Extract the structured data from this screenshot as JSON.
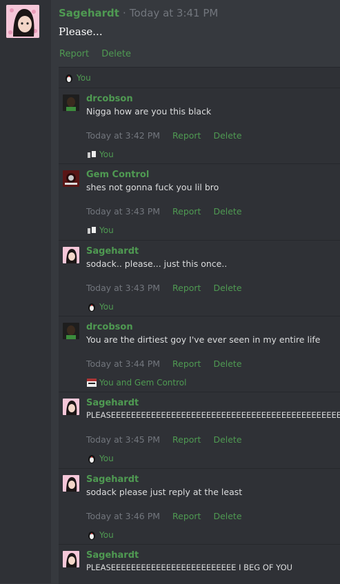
{
  "main": {
    "author": "Sagehardt",
    "separator": "·",
    "time": "Today at 3:41 PM",
    "text": "Please...",
    "actions": [
      "Report",
      "Delete"
    ]
  },
  "thread_reactor": "You",
  "replies": [
    {
      "author": "drcobson",
      "text": "Nigga how are you this black",
      "time": "Today at 3:42 PM",
      "report": "Report",
      "delete": "Delete",
      "reactor": "You",
      "avatar": "drcobson"
    },
    {
      "author": "Gem Control",
      "text": "shes not gonna fuck you lil bro",
      "time": "Today at 3:43 PM",
      "report": "Report",
      "delete": "Delete",
      "reactor": "You",
      "avatar": "gem"
    },
    {
      "author": "Sagehardt",
      "text": "sodack.. please... just this once..",
      "time": "Today at 3:43 PM",
      "report": "Report",
      "delete": "Delete",
      "reactor": "You",
      "avatar": "sage"
    },
    {
      "author": "drcobson",
      "text": "You are the dirtiest goy I've ever seen in my entire life",
      "time": "Today at 3:44 PM",
      "report": "Report",
      "delete": "Delete",
      "reactor": "You and Gem Control",
      "avatar": "drcobson"
    },
    {
      "author": "Sagehardt",
      "text": "PLEASEEEEEEEEEEEEEEEEEEEEEEEEEEEEEEEEEEEEEEEEEEEEEEEEE",
      "time": "Today at 3:45 PM",
      "report": "Report",
      "delete": "Delete",
      "reactor": "You",
      "avatar": "sage"
    },
    {
      "author": "Sagehardt",
      "text": "sodack please just reply at the least",
      "time": "Today at 3:46 PM",
      "report": "Report",
      "delete": "Delete",
      "reactor": "You",
      "avatar": "sage"
    },
    {
      "author": "Sagehardt",
      "text": "PLEASEEEEEEEEEEEEEEEEEEEEEEEEE I BEG OF YOU",
      "avatar": "sage"
    }
  ]
}
